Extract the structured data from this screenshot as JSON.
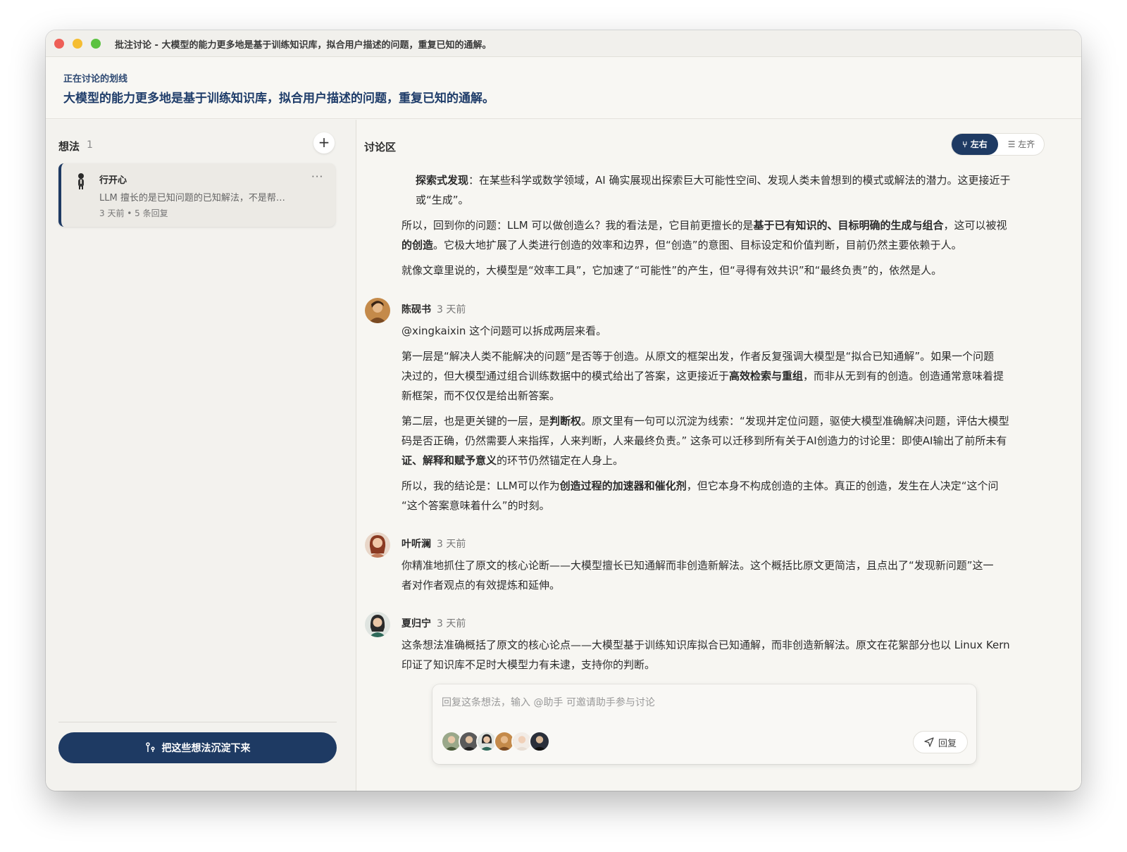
{
  "window": {
    "title": "批注讨论 - 大模型的能力更多地是基于训练知识库，拟合用户描述的问题，重复已知的通解。"
  },
  "highlight": {
    "label": "正在讨论的划线",
    "text": "大模型的能力更多地是基于训练知识库，拟合用户描述的问题，重复已知的通解。"
  },
  "sidebar": {
    "title": "想法",
    "count": "1",
    "add_label": "+",
    "ideas": [
      {
        "author": "行开心",
        "snippet": "LLM 擅长的是已知问题的已知解法，不是帮…",
        "meta": "3 天前 • 5 条回复",
        "more": "···"
      }
    ],
    "sediment_button": "把这些想法沉淀下来"
  },
  "main": {
    "title": "讨论区",
    "toggle": {
      "active": "左右",
      "inactive": "左齐"
    },
    "top_message": {
      "p1_bold": "探索式发现",
      "p1_rest": "：在某些科学或数学领域，AI 确实展现出探索巨大可能性空间、发现人类未曾想到的模式或解法的潜力。这更接近于",
      "p1_line2": "或“生成”。",
      "p2_pre": "所以，回到你的问题：LLM 可以做创造么？我的看法是，它目前更擅长的是",
      "p2_bold": "基于已有知识的、目标明确的生成与组合",
      "p2_post": "，这可以被视",
      "p2_line2_bold": "的创造",
      "p2_line2_rest": "。它极大地扩展了人类进行创造的效率和边界，但“创造”的意图、目标设定和价值判断，目前仍然主要依赖于人。",
      "p3": "就像文章里说的，大模型是“效率工具”，它加速了“可能性”的产生，但“寻得有效共识”和“最终负责”的，依然是人。"
    },
    "comments": [
      {
        "name": "陈砚书",
        "time": "3 天前",
        "lines": {
          "l1": "@xingkaixin 这个问题可以拆成两层来看。",
          "l2": "第一层是“解决人类不能解决的问题”是否等于创造。从原文的框架出发，作者反复强调大模型是“拟合已知通解”。如果一个问题",
          "l3_pre": "决过的，但大模型通过组合训练数据中的模式给出了答案，这更接近于",
          "l3_bold": "高效检索与重组",
          "l3_post": "，而非从无到有的创造。创造通常意味着提",
          "l4": "新框架，而不仅仅是给出新答案。",
          "l5_pre": "第二层，也是更关键的一层，是",
          "l5_bold": "判断权",
          "l5_post": "。原文里有一句可以沉淀为线索：“发现并定位问题，驱使大模型准确解决问题，评估大模型",
          "l6": "码是否正确，仍然需要人来指挥，人来判断，人来最终负责。” 这条可以迁移到所有关于AI创造力的讨论里：即使AI输出了前所未有",
          "l7_bold": "证、解释和赋予意义",
          "l7_rest": "的环节仍然锚定在人身上。",
          "l8_pre": "所以，我的结论是：LLM可以作为",
          "l8_bold": "创造过程的加速器和催化剂",
          "l8_post": "，但它本身不构成创造的主体。真正的创造，发生在人决定“这个问",
          "l9": "“这个答案意味着什么”的时刻。"
        }
      },
      {
        "name": "叶听澜",
        "time": "3 天前",
        "lines": {
          "l1": "你精准地抓住了原文的核心论断——大模型擅长已知通解而非创造新解法。这个概括比原文更简洁，且点出了“发现新问题”这一",
          "l2": "者对作者观点的有效提炼和延伸。"
        }
      },
      {
        "name": "夏归宁",
        "time": "3 天前",
        "lines": {
          "l1": "这条想法准确概括了原文的核心论点——大模型基于训练知识库拟合已知通解，而非创造新解法。原文在花絮部分也以 Linux Kern",
          "l2": "印证了知识库不足时大模型力有未逮，支持你的判断。"
        }
      }
    ],
    "reply": {
      "placeholder": "回复这条想法，输入 @助手 可邀请助手参与讨论",
      "button": "回复"
    }
  },
  "colors": {
    "accent": "#1e3a63",
    "highlight_text": "#1f3d6a"
  }
}
